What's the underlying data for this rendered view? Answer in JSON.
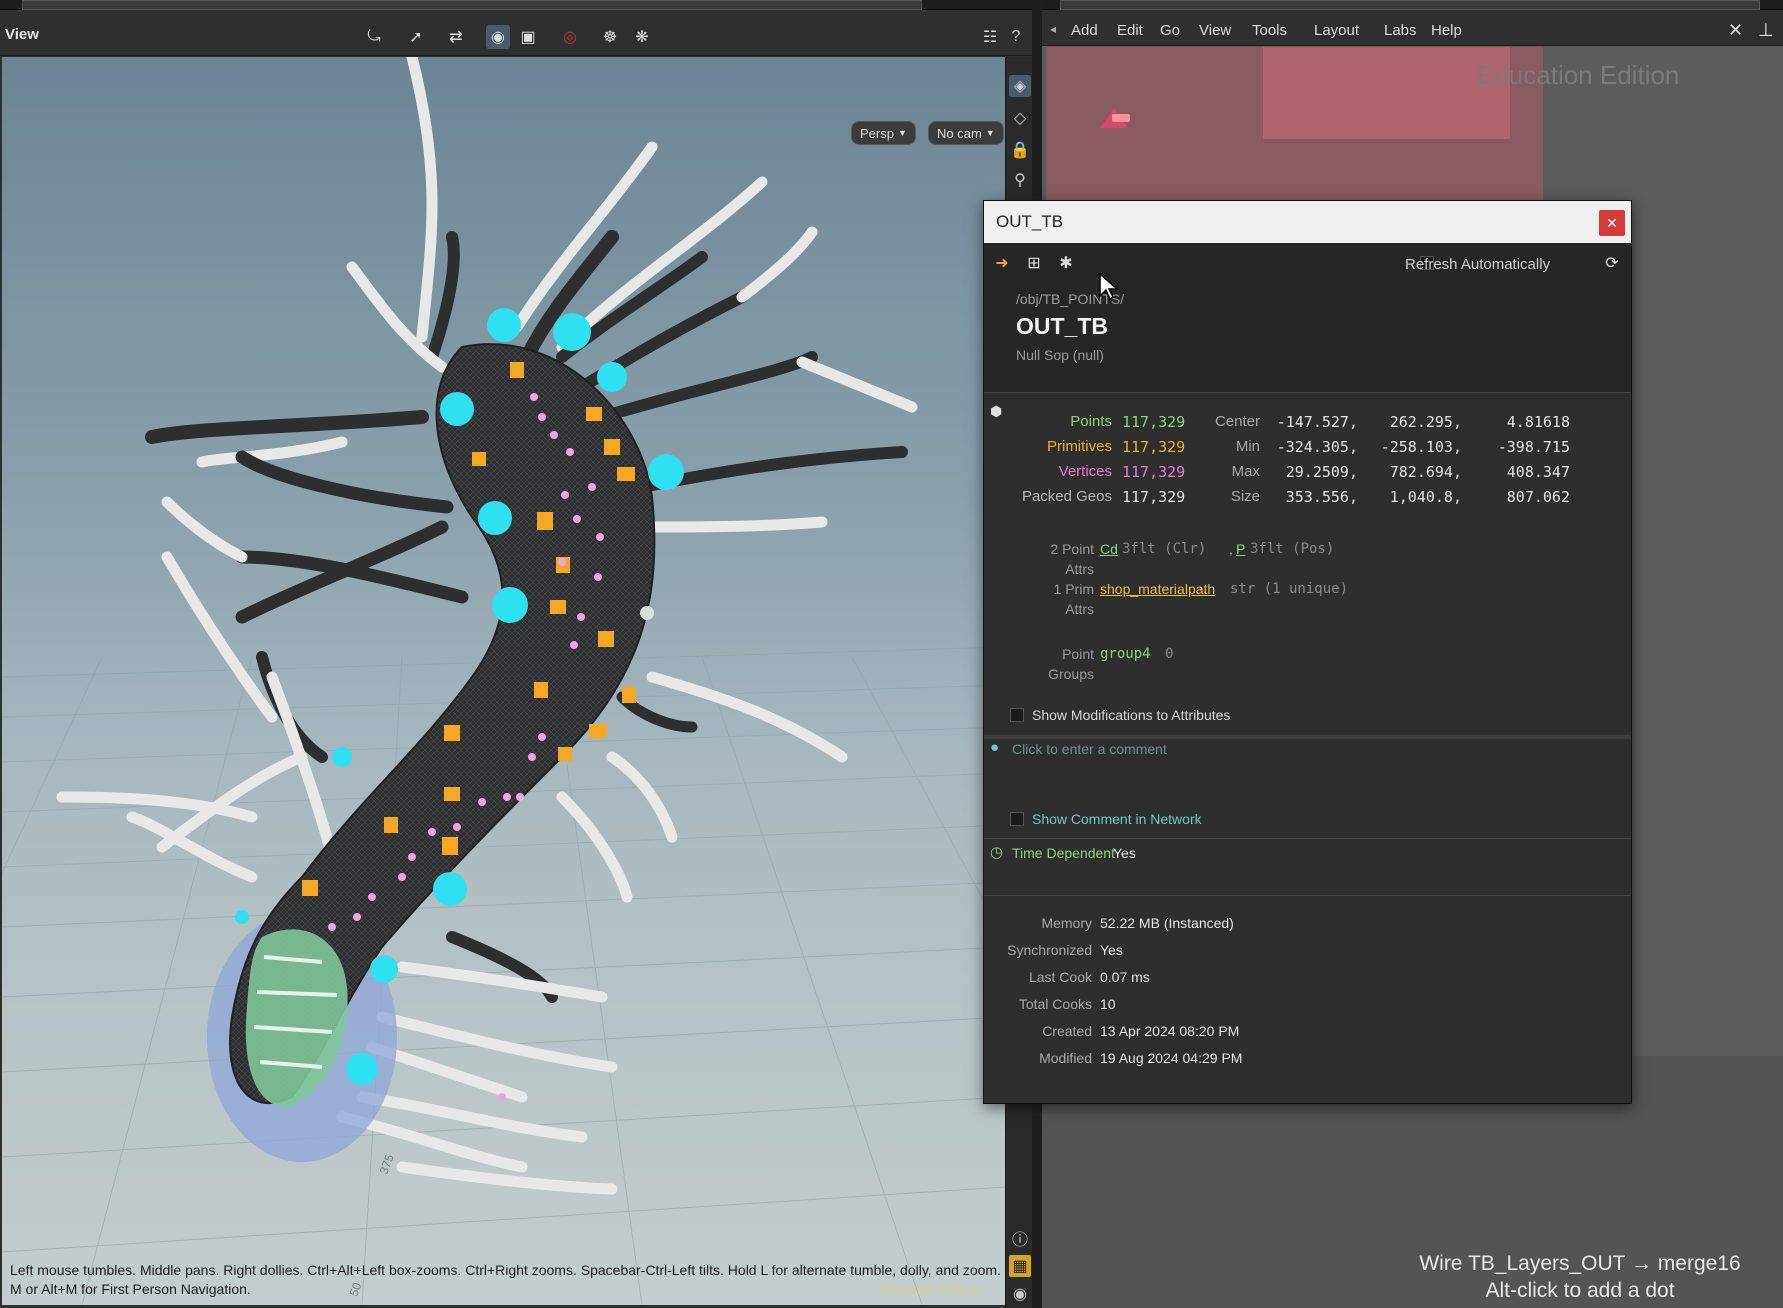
{
  "viewport": {
    "title": "View",
    "persp_label": "Persp",
    "cam_label": "No cam",
    "help_line1": "Left mouse tumbles. Middle pans. Right dollies. Ctrl+Alt+Left box-zooms. Ctrl+Right zooms. Spacebar-Ctrl-Left tilts. Hold L for alternate tumble, dolly, and zoom.",
    "help_line2": "M or Alt+M for First Person Navigation.",
    "edition": "Education Edition",
    "grid_label_a": "375",
    "grid_label_b": "50"
  },
  "network": {
    "menu": [
      "Add",
      "Edit",
      "Go",
      "View",
      "Tools",
      "Layout",
      "Labs",
      "Help"
    ],
    "watermark": "Education Edition",
    "wire_line1": "Wire TB_Layers_OUT → merge16",
    "wire_line2": "Alt-click to add a dot"
  },
  "info": {
    "window_title": "OUT_TB",
    "refresh_label": "Refresh Automatically",
    "path": "/obj/TB_POINTS/",
    "name": "OUT_TB",
    "type": "Null Sop (null)",
    "counts": [
      {
        "label": "Points",
        "value": "117,329",
        "color": "#8fd07a"
      },
      {
        "label": "Primitives",
        "value": "117,329",
        "color": "#e6b030"
      },
      {
        "label": "Vertices",
        "value": "117,329",
        "color": "#e07ad0"
      },
      {
        "label": "Packed Geos",
        "value": "117,329",
        "color": "#b8b8b8"
      }
    ],
    "bounds": [
      {
        "label": "Center",
        "x": "-147.527,",
        "y": "262.295,",
        "z": "4.81618"
      },
      {
        "label": "Min",
        "x": "-324.305,",
        "y": "-258.103,",
        "z": "-398.715"
      },
      {
        "label": "Max",
        "x": "29.2509,",
        "y": "782.694,",
        "z": "408.347"
      },
      {
        "label": "Size",
        "x": "353.556,",
        "y": "1,040.8,",
        "z": "807.062"
      }
    ],
    "point_attrs": {
      "kind": "2 Point",
      "kind2": "Attrs",
      "a1": "Cd",
      "a1_type": "3flt (Clr)",
      "sep": ",",
      "a2": "P",
      "a2_type": "3flt (Pos)"
    },
    "prim_attrs": {
      "kind": "1 Prim",
      "kind2": "Attrs",
      "a1": "shop_materialpath",
      "a1_type": "str (1 unique)"
    },
    "point_groups": {
      "kind": "Point",
      "kind2": "Groups",
      "name": "group4",
      "count": "0"
    },
    "show_mods": "Show Modifications to Attributes",
    "comment_placeholder": "Click to enter a comment",
    "show_comment": "Show Comment in Network",
    "time_dependent_label": "Time Dependent",
    "time_dependent_value": "Yes",
    "meta": [
      {
        "label": "Memory",
        "value": "52.22 MB (Instanced)"
      },
      {
        "label": "Synchronized",
        "value": "Yes"
      },
      {
        "label": "Last Cook",
        "value": "0.07 ms"
      },
      {
        "label": "Total Cooks",
        "value": "10"
      },
      {
        "label": "Created",
        "value": "13 Apr 2024 08:20 PM"
      },
      {
        "label": "Modified",
        "value": "19 Aug 2024 04:29 PM"
      }
    ]
  },
  "colors": {
    "accent_cyan": "#2fe0f0",
    "accent_orange": "#f5a623",
    "accent_pink": "#f1a2e6",
    "close_red": "#d33b3b",
    "link_yellow": "#e6c040",
    "teal_text": "#6fc7c0"
  }
}
